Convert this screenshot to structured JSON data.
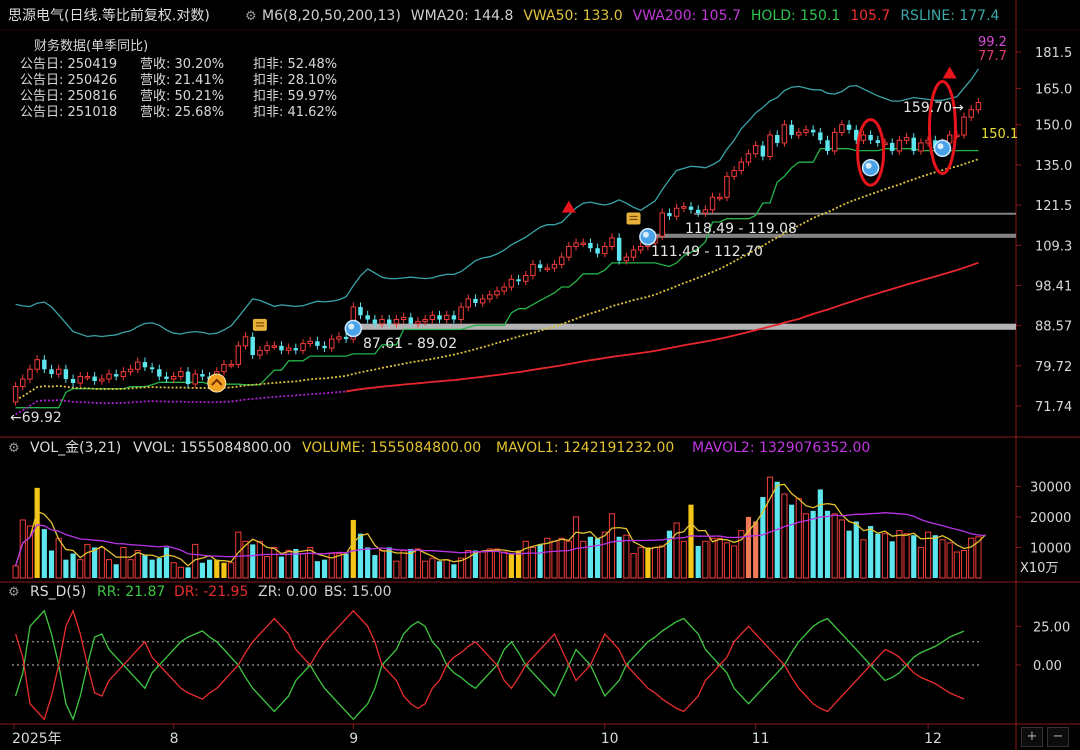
{
  "colors": {
    "bg": "#000000",
    "up": "#f23b3b",
    "down": "#5ee6ee",
    "axis": "#8a1a1a",
    "grid_text": "#d8d8d8",
    "wma20": "#3aa3a6",
    "vwa50": "#e0c33c",
    "vwa200": "#b21fd6",
    "hold": "#26b34a",
    "rsline": "#e8262e",
    "vol_ma1": "#e3c32f",
    "vol_ma2": "#b933e6",
    "rr": "#3fc542",
    "dr": "#e72e2e",
    "highlight_vol": "#f5c518",
    "ring": "#e8141c"
  },
  "price_panel": {
    "title": "思源电气(日线.等比前复权.对数)",
    "indicators": [
      {
        "text": "M6(8,20,50,200,13)",
        "color": "#d0d0d0"
      },
      {
        "text": "WMA20: 144.8",
        "color": "#d0d0d0"
      },
      {
        "text": "VWA50: 133.0",
        "color": "#e0c33c"
      },
      {
        "text": "VWA200: 105.7",
        "color": "#c237d8"
      },
      {
        "text": "HOLD: 150.1",
        "color": "#2fc44e"
      },
      {
        "text": "105.7",
        "color": "#ee3030"
      },
      {
        "text": "RSLINE: 177.4",
        "color": "#3aa7a8"
      }
    ],
    "fin_title": "财务数据(单季同比)",
    "fin_rows": [
      {
        "date": "公告日: 250419",
        "rev": "营收:  30.20%",
        "net": "扣非:  52.48%"
      },
      {
        "date": "公告日: 250426",
        "rev": "营收:  21.41%",
        "net": "扣非:  28.10%"
      },
      {
        "date": "公告日: 250816",
        "rev": "营收:  50.21%",
        "net": "扣非:  59.97%"
      },
      {
        "date": "公告日: 251018",
        "rev": "营收:  25.68%",
        "net": "扣非:  41.62%"
      }
    ],
    "y_ticks": [
      "181.5",
      "165.0",
      "150.0",
      "135.0",
      "121.5",
      "109.3",
      "98.41",
      "88.57",
      "79.72",
      "71.74"
    ],
    "tag_rs_top": "99.2",
    "tag_rs_2": "77.7",
    "hold_tag": "150.1",
    "low_marker": "69.92",
    "high_marker": "159.70",
    "zones": [
      "87.61 - 89.02",
      "111.49 - 112.70",
      "118.49 - 119.08"
    ]
  },
  "volume_panel": {
    "title": "VOL_金(3,21)",
    "vvol": "VVOL: 1555084800.00",
    "volume": "VOLUME: 1555084800.00",
    "mavol1": "MAVOL1: 1242191232.00",
    "mavol2": "MAVOL2: 1329076352.00",
    "y_ticks": [
      "30000",
      "20000",
      "10000"
    ],
    "unit": "X10万"
  },
  "rs_panel": {
    "title": "RS_D(5)",
    "rr": "RR: 21.87",
    "dr": "DR: -21.95",
    "zr": "ZR: 0.00",
    "bs": "BS: 15.00",
    "y_ticks": [
      "25.00",
      "0.00"
    ]
  },
  "x_axis": [
    "2025年",
    "8",
    "9",
    "10",
    "11",
    "12"
  ],
  "buttons": {
    "plus": "+",
    "minus": "−"
  },
  "chart_data": {
    "type": "candlestick",
    "title": "思源电气(日线.等比前复权.对数)",
    "y_scale": "log",
    "price_ylim": [
      71.74,
      181.5
    ],
    "vol_ylim": [
      0,
      36000
    ],
    "rs_ylim": [
      -37,
      37
    ],
    "open": [
      72.5,
      75.5,
      77,
      79,
      81,
      79,
      78,
      79,
      77,
      76.2,
      77.5,
      77.5,
      76.6,
      77,
      78,
      77.5,
      78.5,
      79,
      80.5,
      79.4,
      79,
      77.5,
      77,
      77.5,
      78.5,
      76,
      78,
      77.5,
      77,
      78.5,
      80,
      80,
      84,
      86,
      82,
      83,
      84,
      84,
      83,
      83.5,
      83,
      84.5,
      85,
      84,
      83.5,
      85.5,
      86,
      85.5,
      93,
      91,
      90,
      89,
      90,
      89,
      90,
      90.5,
      89,
      89.5,
      90,
      91,
      90,
      91,
      90,
      93,
      95,
      94,
      95,
      96,
      97,
      98,
      100,
      99.5,
      101,
      104,
      103,
      103,
      104,
      106,
      109,
      110,
      110,
      108.5,
      107,
      109,
      111.5,
      105,
      106,
      108,
      109,
      110,
      112,
      119,
      118,
      120.5,
      121,
      120,
      119,
      120,
      124,
      124,
      131,
      133,
      136,
      139,
      142,
      138,
      146,
      143,
      150,
      146,
      147,
      148,
      147,
      144,
      140,
      147,
      150,
      148,
      144,
      146,
      144,
      143,
      143,
      140,
      144,
      145,
      140,
      143,
      144,
      141,
      143,
      146,
      146,
      153,
      156
    ],
    "close": [
      75.5,
      77,
      79,
      81,
      79,
      78,
      79,
      77,
      76.2,
      77.5,
      77.5,
      76.6,
      77,
      78,
      77.5,
      78.5,
      79,
      80.5,
      79.4,
      79,
      77.5,
      77,
      77.5,
      78.5,
      76,
      78,
      77.5,
      77,
      78.5,
      80,
      80,
      84,
      86,
      82,
      83,
      84,
      84,
      83,
      83.5,
      83,
      84.5,
      85,
      84,
      83.5,
      85.5,
      86,
      85.5,
      93,
      91,
      90,
      89,
      90,
      89,
      90,
      90.5,
      89,
      89.5,
      90,
      91,
      90,
      91,
      90,
      93,
      95,
      94,
      95,
      96,
      97,
      98,
      100,
      99.5,
      101,
      104,
      103,
      103,
      104,
      106,
      109,
      110,
      110,
      108.5,
      107,
      109,
      111.5,
      105,
      106,
      108,
      109,
      110,
      112,
      119,
      118,
      120.5,
      121,
      120,
      119,
      120,
      124,
      124,
      131,
      133,
      136,
      139,
      142,
      138,
      146,
      143,
      150,
      146,
      147,
      148,
      147,
      144,
      140,
      147,
      150,
      148,
      144,
      146,
      144,
      143,
      143,
      140,
      144,
      145,
      140,
      143,
      144,
      141,
      143,
      146,
      146,
      153,
      156,
      159
    ],
    "volume": [
      4000,
      19000,
      17000,
      29500,
      16000,
      9000,
      13000,
      6000,
      8000,
      6000,
      11000,
      10000,
      10000,
      6000,
      4500,
      10000,
      6000,
      9000,
      7500,
      6000,
      6500,
      10000,
      5000,
      3500,
      3500,
      11000,
      5000,
      6000,
      6000,
      5000,
      5000,
      15000,
      12000,
      11000,
      12000,
      7000,
      10000,
      7000,
      9000,
      9500,
      8000,
      10000,
      5500,
      6000,
      8000,
      8000,
      8000,
      19000,
      14500,
      10000,
      7500,
      9000,
      10000,
      5500,
      9000,
      9500,
      9500,
      5500,
      6500,
      5500,
      6000,
      4500,
      6500,
      9000,
      9000,
      8500,
      9500,
      9500,
      8500,
      8000,
      9000,
      12000,
      10000,
      11000,
      13000,
      12000,
      13000,
      12000,
      20000,
      12000,
      13500,
      13000,
      15000,
      21000,
      13500,
      14000,
      8000,
      10000,
      10000,
      10000,
      10500,
      15500,
      18000,
      12000,
      24000,
      10500,
      12000,
      13000,
      13000,
      11500,
      10500,
      15500,
      20000,
      18500,
      26500,
      33000,
      31500,
      27500,
      24000,
      26000,
      21000,
      22000,
      29000,
      22000,
      21000,
      19000,
      15500,
      18500,
      12500,
      17000,
      14500,
      14500,
      12000,
      15500,
      14500,
      14000,
      10000,
      15000,
      14000,
      12500,
      11500,
      8500,
      9000,
      13000,
      13500,
      16000
    ],
    "highlight_volume_bars": [
      3,
      28,
      29,
      47,
      69,
      70,
      88,
      94,
      102,
      103
    ],
    "rs_rr": [
      -20,
      -5,
      25,
      30,
      35,
      20,
      0,
      -25,
      -35,
      -20,
      0,
      18,
      20,
      10,
      5,
      0,
      -5,
      -10,
      -15,
      -5,
      0,
      5,
      10,
      15,
      18,
      20,
      22,
      18,
      15,
      10,
      5,
      0,
      -8,
      -15,
      -20,
      -25,
      -30,
      -25,
      -20,
      -10,
      -5,
      0,
      -8,
      -15,
      -20,
      -25,
      -30,
      -35,
      -30,
      -25,
      -15,
      0,
      5,
      10,
      20,
      25,
      28,
      25,
      15,
      10,
      0,
      -5,
      -8,
      -12,
      -15,
      -10,
      -5,
      0,
      10,
      15,
      8,
      0,
      -5,
      -10,
      -15,
      -20,
      -10,
      0,
      10,
      5,
      0,
      -10,
      -20,
      -15,
      -10,
      0,
      5,
      10,
      15,
      18,
      22,
      25,
      28,
      30,
      25,
      20,
      10,
      5,
      0,
      -5,
      -15,
      -20,
      -25,
      -20,
      -15,
      -10,
      -5,
      0,
      8,
      15,
      20,
      25,
      28,
      30,
      25,
      20,
      15,
      10,
      5,
      0,
      -5,
      -10,
      -8,
      -5,
      0,
      5,
      8,
      10,
      12,
      15,
      18,
      20,
      21.87
    ],
    "rs_dr": [
      20,
      5,
      -25,
      -30,
      -35,
      -20,
      0,
      25,
      35,
      20,
      0,
      -18,
      -20,
      -10,
      -5,
      0,
      5,
      10,
      15,
      5,
      0,
      -5,
      -10,
      -15,
      -18,
      -20,
      -22,
      -18,
      -15,
      -10,
      -5,
      0,
      8,
      15,
      20,
      25,
      30,
      25,
      20,
      10,
      5,
      0,
      8,
      15,
      20,
      25,
      30,
      35,
      30,
      25,
      15,
      0,
      -5,
      -10,
      -20,
      -25,
      -28,
      -25,
      -15,
      -10,
      0,
      5,
      8,
      12,
      15,
      10,
      5,
      0,
      -10,
      -15,
      -8,
      0,
      5,
      10,
      15,
      20,
      10,
      0,
      -10,
      -5,
      0,
      10,
      20,
      15,
      10,
      0,
      -5,
      -10,
      -15,
      -18,
      -22,
      -25,
      -28,
      -30,
      -25,
      -20,
      -10,
      -5,
      0,
      5,
      15,
      20,
      25,
      20,
      15,
      10,
      5,
      0,
      -8,
      -15,
      -20,
      -25,
      -28,
      -30,
      -25,
      -20,
      -15,
      -10,
      -5,
      0,
      5,
      10,
      8,
      5,
      0,
      -5,
      -8,
      -10,
      -12,
      -15,
      -18,
      -20,
      -21.95
    ],
    "rs_reference_line": 15,
    "series": [
      {
        "name": "WMA20",
        "last": 144.8
      },
      {
        "name": "VWA50",
        "last": 133.0
      },
      {
        "name": "VWA200",
        "last": 105.7
      },
      {
        "name": "HOLD",
        "last": 150.1
      },
      {
        "name": "RSLINE",
        "last": 177.4
      }
    ],
    "zone_lines": [
      {
        "label": "87.61 - 89.02",
        "lo": 87.61,
        "hi": 89.02,
        "from_bar": 47
      },
      {
        "label": "111.49 - 112.70",
        "lo": 111.49,
        "hi": 112.7,
        "from_bar": 89
      },
      {
        "label": "118.49 - 119.08",
        "lo": 118.49,
        "hi": 119.08,
        "from_bar": 95
      }
    ],
    "x_ticks": [
      {
        "label": "2025年",
        "bar": 0
      },
      {
        "label": "8",
        "bar": 22
      },
      {
        "label": "9",
        "bar": 47
      },
      {
        "label": "10",
        "bar": 82
      },
      {
        "label": "11",
        "bar": 103
      },
      {
        "label": "12",
        "bar": 127
      }
    ]
  }
}
